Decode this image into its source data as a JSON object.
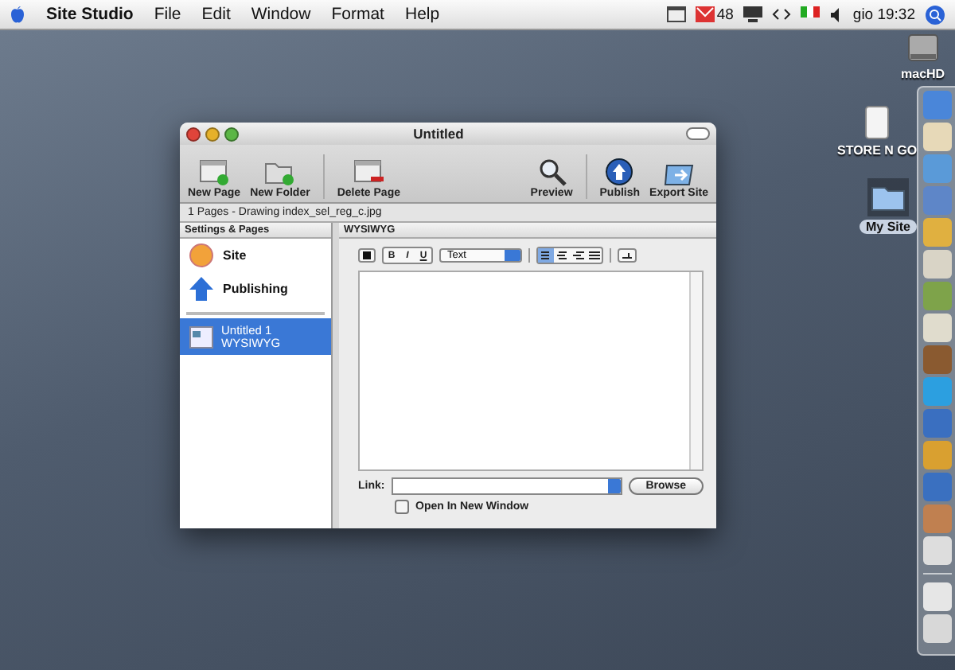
{
  "menubar": {
    "app_name": "Site Studio",
    "menus": [
      "File",
      "Edit",
      "Window",
      "Format",
      "Help"
    ],
    "mail_count": "48",
    "clock": "gio 19:32"
  },
  "desktop_icons": [
    {
      "kind": "disk",
      "label": "macHD",
      "selected": false
    },
    {
      "kind": "drive",
      "label": "STORE N GO",
      "selected": false
    },
    {
      "kind": "folder",
      "label": "My Site",
      "selected": true
    }
  ],
  "window": {
    "title": "Untitled",
    "toolbar": [
      {
        "kind": "page",
        "label": "New Page"
      },
      {
        "kind": "folder",
        "label": "New Folder"
      },
      {
        "kind": "delete",
        "label": "Delete Page"
      },
      {
        "kind": "preview",
        "label": "Preview"
      },
      {
        "kind": "publish",
        "label": "Publish"
      },
      {
        "kind": "export",
        "label": "Export Site"
      }
    ],
    "path_bar": "1 Pages - Drawing index_sel_reg_c.jpg",
    "sidebar": {
      "header": "Settings & Pages",
      "settings": [
        {
          "kind": "site",
          "label": "Site"
        },
        {
          "kind": "publishing",
          "label": "Publishing"
        }
      ],
      "pages": [
        {
          "title": "Untitled 1",
          "subtitle": "WYSIWYG",
          "selected": true
        }
      ]
    },
    "editor": {
      "header": "WYSIWYG",
      "format_buttons": [
        "B",
        "I",
        "U"
      ],
      "style_select": "Text",
      "align_buttons": [
        {
          "kind": "left",
          "selected": true
        },
        {
          "kind": "center",
          "selected": false
        },
        {
          "kind": "right",
          "selected": false
        },
        {
          "kind": "justify",
          "selected": false
        }
      ],
      "link_label": "Link:",
      "browse_button": "Browse",
      "new_window": {
        "label": "Open In New Window",
        "checked": false
      }
    }
  }
}
